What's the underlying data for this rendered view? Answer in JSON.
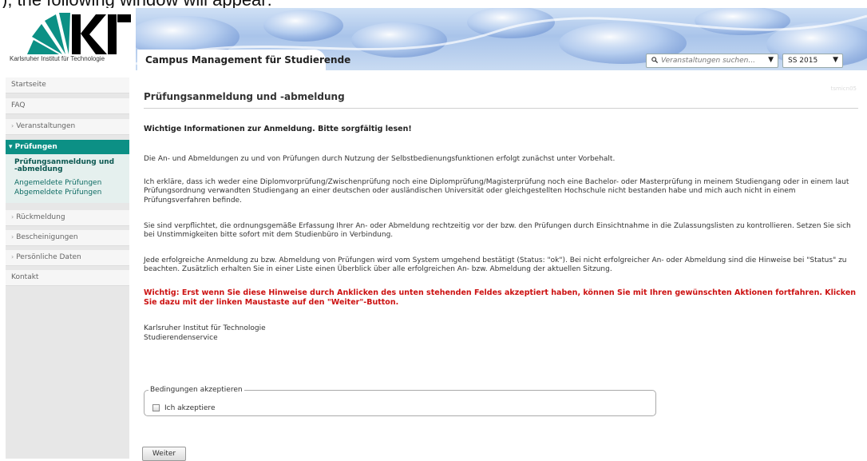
{
  "caption": "), the following window will appear:",
  "header": {
    "logo_text": "KIT",
    "logo_subtitle": "Karlsruher Institut für Technologie",
    "app_title": "Campus Management für Studierende",
    "search_placeholder": "Veranstaltungen suchen...",
    "semester_value": "SS 2015"
  },
  "sidebar": {
    "items": [
      {
        "label": "Startseite"
      },
      {
        "label": "FAQ"
      },
      {
        "label": "Veranstaltungen"
      },
      {
        "label": "Prüfungen"
      },
      {
        "label": "Rückmeldung"
      },
      {
        "label": "Bescheinigungen"
      },
      {
        "label": "Persönliche Daten"
      },
      {
        "label": "Kontakt"
      }
    ],
    "subitems": [
      {
        "label_line1": "Prüfungsanmeldung und",
        "label_line2": "-abmeldung"
      },
      {
        "label": "Angemeldete Prüfungen"
      },
      {
        "label": "Abgemeldete Prüfungen"
      }
    ]
  },
  "main": {
    "page_title": "Prüfungsanmeldung und -abmeldung",
    "ghost_id": "tsmicn05",
    "info_heading": "Wichtige Informationen zur Anmeldung. Bitte sorgfältig lesen!",
    "paragraphs": [
      "Die An- und Abmeldungen zu und von Prüfungen durch Nutzung der Selbstbedienungsfunktionen erfolgt zunächst unter Vorbehalt.",
      "Ich erkläre, dass ich weder eine Diplomvorprüfung/Zwischenprüfung noch eine Diplomprüfung/Magisterprüfung noch eine Bachelor- oder Masterprüfung in meinem Studiengang oder in einem laut Prüfungsordnung verwandten Studiengang an einer deutschen oder ausländischen Universität oder gleichgestellten Hochschule nicht bestanden habe und mich auch nicht in einem Prüfungsverfahren befinde.",
      "Sie sind verpflichtet, die ordnungsgemäße Erfassung Ihrer An- oder Abmeldung rechtzeitig vor der bzw. den Prüfungen durch Einsichtnahme in die Zulassungslisten zu kontrollieren. Setzen Sie sich bei Unstimmigkeiten bitte sofort mit dem Studienbüro in Verbindung.",
      "Jede erfolgreiche Anmeldung zu bzw. Abmeldung von Prüfungen wird vom System umgehend bestätigt (Status: \"ok\"). Bei nicht erfolgreicher An- oder Abmeldung sind die Hinweise bei \"Status\" zu beachten. Zusätzlich erhalten Sie in einer Liste einen Überblick über alle erfolgreichen An- bzw. Abmeldung der aktuellen Sitzung."
    ],
    "warning": "Wichtig: Erst wenn Sie diese Hinweise durch Anklicken des unten stehenden Feldes akzeptiert haben, können Sie mit Ihren gewünschten Aktionen fortfahren. Klicken Sie dazu mit der linken Maustaste auf den \"Weiter\"-Button.",
    "signature_line1": "Karlsruher Institut für Technologie",
    "signature_line2": "Studierendenservice",
    "accept_legend": "Bedingungen akzeptieren",
    "accept_label": "Ich akzeptiere",
    "continue_button": "Weiter"
  },
  "colors": {
    "accent": "#0c9085",
    "warning": "#cc1111"
  }
}
